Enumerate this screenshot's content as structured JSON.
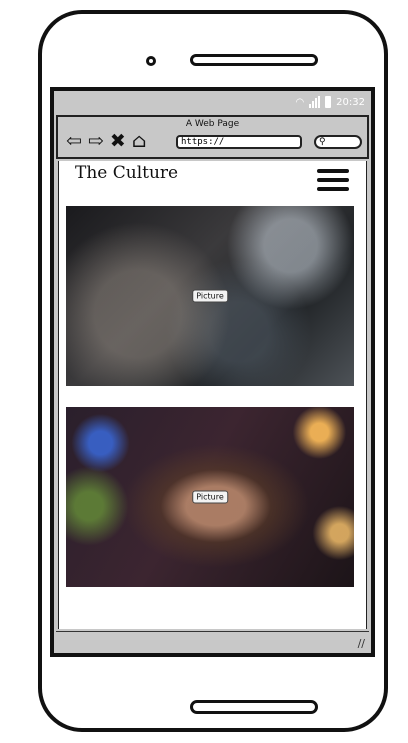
{
  "status_bar": {
    "time": "20:32",
    "icons": [
      "wifi-icon",
      "signal-icon",
      "battery-icon"
    ]
  },
  "browser": {
    "title": "A Web Page",
    "url": "https://",
    "search_icon": "search-icon",
    "nav_icons": [
      "back-arrow-icon",
      "forward-arrow-icon",
      "close-icon",
      "home-icon"
    ]
  },
  "site": {
    "title": "The Culture",
    "menu_icon": "hamburger-menu-icon"
  },
  "pictures": [
    {
      "label": "Picture",
      "subject": "photo"
    },
    {
      "label": "Picture",
      "subject": "photo"
    }
  ]
}
